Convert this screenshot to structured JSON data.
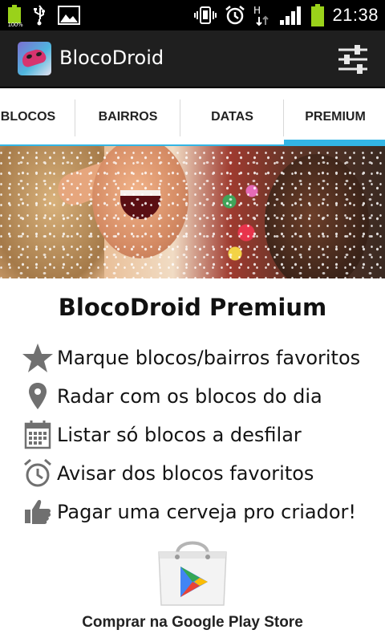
{
  "status_bar": {
    "battery_small_label": "100%",
    "time": "21:38",
    "icons": [
      "battery-icon",
      "usb-icon",
      "gallery-icon",
      "vibrate-icon",
      "alarm-icon",
      "data-transfer-icon",
      "signal-icon",
      "battery-icon"
    ]
  },
  "action_bar": {
    "title": "BlocoDroid",
    "app_icon": "carnival-mask-icon",
    "settings_icon": "settings-sliders-icon"
  },
  "tabs": [
    {
      "label": "BLOCOS",
      "active": false
    },
    {
      "label": "BAIRROS",
      "active": false
    },
    {
      "label": "DATAS",
      "active": false
    },
    {
      "label": "PREMIUM",
      "active": true
    }
  ],
  "premium": {
    "title": "BlocoDroid Premium",
    "features": [
      {
        "icon": "star-icon",
        "text": "Marque blocos/bairros favoritos"
      },
      {
        "icon": "map-pin-icon",
        "text": "Radar com os blocos do dia"
      },
      {
        "icon": "calendar-icon",
        "text": "Listar só blocos a desfilar"
      },
      {
        "icon": "alarm-clock-icon",
        "text": "Avisar dos blocos favoritos"
      },
      {
        "icon": "thumbs-up-icon",
        "text": "Pagar uma cerveja pro criador!"
      }
    ],
    "store_icon": "google-play-bag-icon",
    "store_label": "Comprar na Google Play Store"
  },
  "colors": {
    "accent": "#33b5e5",
    "action_bar_bg": "#1f1f1f",
    "status_bar_bg": "#000000",
    "battery": "#9ad21a",
    "icon_gray": "#707070"
  }
}
